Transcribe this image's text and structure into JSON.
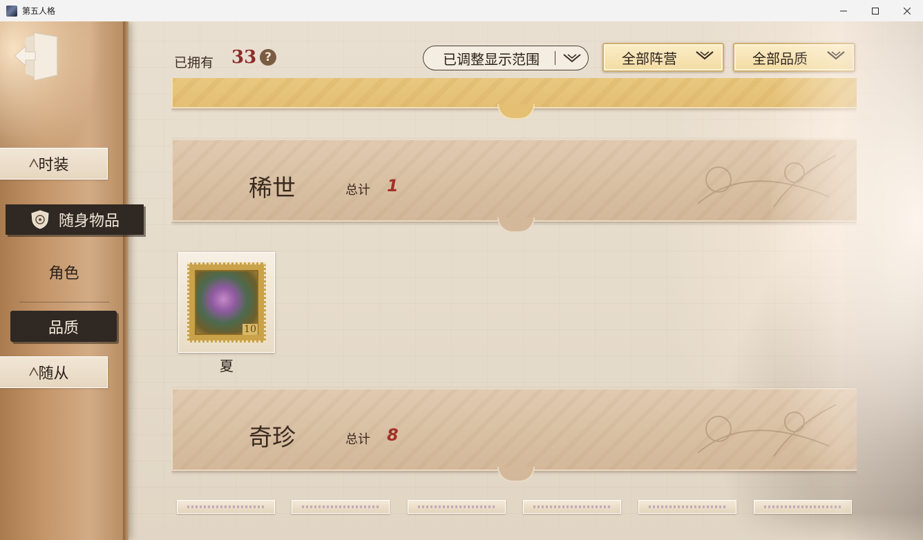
{
  "window": {
    "title": "第五人格",
    "minimize_icon": "minimize-icon",
    "maximize_icon": "maximize-icon",
    "close_icon": "close-icon"
  },
  "header": {
    "owned_label": "已拥有",
    "owned_count": "33",
    "help_glyph": "?",
    "filters": {
      "range": "已调整显示范围",
      "faction": "全部阵营",
      "quality": "全部品质"
    }
  },
  "sidebar": {
    "back_icon": "exit-door-icon",
    "tabs": [
      {
        "label": "时装"
      },
      {
        "label": "随身物品"
      },
      {
        "label": "角色"
      },
      {
        "label": "品质"
      },
      {
        "label": "随从"
      }
    ]
  },
  "sections": [
    {
      "title": "稀世",
      "total_label": "总计",
      "total": "1",
      "items": [
        {
          "name": "夏",
          "value_mark": "10"
        }
      ]
    },
    {
      "title": "奇珍",
      "total_label": "总计",
      "total": "8"
    }
  ],
  "colors": {
    "accent_red": "#8b2d2b",
    "active_tab": "#2f2823",
    "gold_button": "#f3dba2"
  }
}
